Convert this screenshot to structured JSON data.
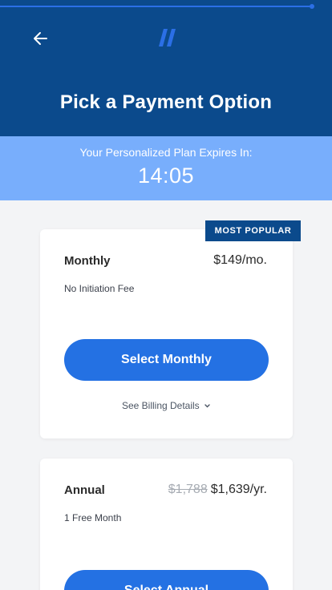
{
  "header": {
    "title": "Pick a Payment Option",
    "progress": 0.94
  },
  "timer": {
    "label": "Your Personalized Plan Expires In:",
    "value": "14:05"
  },
  "plans": [
    {
      "name": "Monthly",
      "price": "$149/mo.",
      "note": "No Initiation Fee",
      "badge": "MOST POPULAR",
      "button_label": "Select Monthly",
      "details_link": "See Billing Details"
    },
    {
      "name": "Annual",
      "original_price": "$1,788",
      "price": "$1,639/yr.",
      "note": "1 Free Month",
      "button_label": "Select Annual"
    }
  ],
  "icons": {
    "back": "arrow-left-icon",
    "logo": "brand-slash-logo",
    "details": "chevron-down-icon"
  },
  "colors": {
    "header_bg": "#0b4a8c",
    "timer_bg": "#78aefc",
    "button": "#2471e3",
    "badge_bg": "#0b4a8c"
  }
}
